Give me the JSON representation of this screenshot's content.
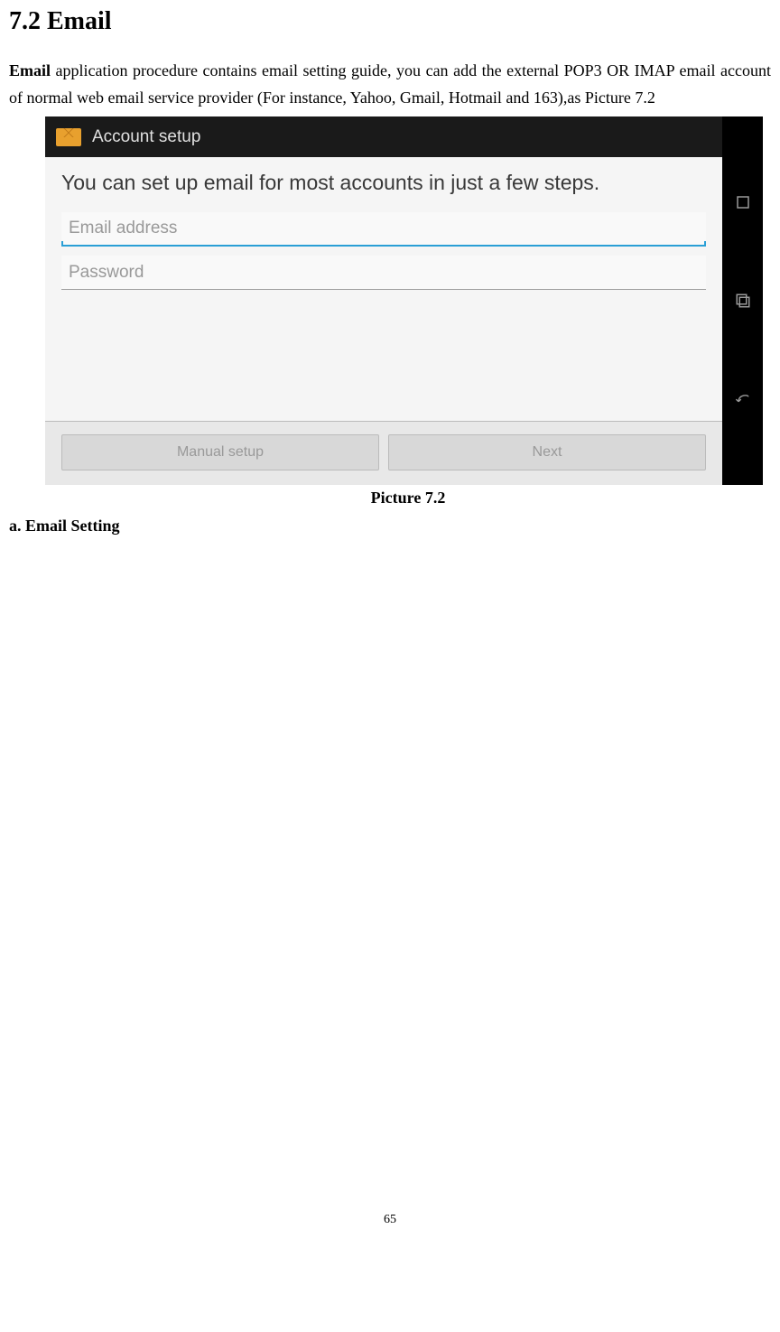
{
  "section_title": "7.2 Email",
  "paragraph_lead": "Email",
  "paragraph_rest": " application procedure contains email setting guide, you can add the external POP3 OR IMAP email account of normal web email service provider (For instance, Yahoo, Gmail, Hotmail and 163),as Picture 7.2",
  "screenshot": {
    "header_title": "Account setup",
    "intro_text": "You can set up email for most accounts in just a few steps.",
    "email_placeholder": "Email address",
    "password_placeholder": "Password",
    "manual_setup_label": "Manual setup",
    "next_label": "Next"
  },
  "caption": "Picture 7.2",
  "subheading": "a. Email Setting",
  "page_number": "65"
}
